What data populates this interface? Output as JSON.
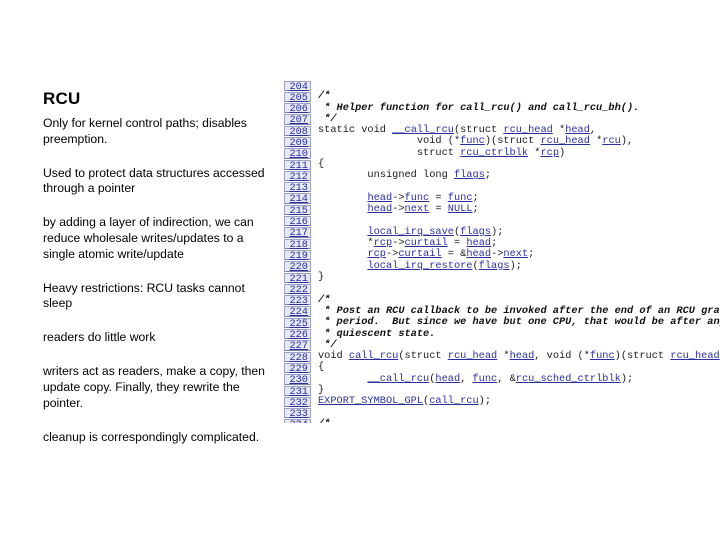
{
  "slide": {
    "title": "RCU",
    "bullets": [
      "Only for kernel control paths; disables preemption.",
      "Used to protect data structures accessed through a pointer",
      "by adding a layer of indirection, we can reduce wholesale writes/updates to a single atomic write/update",
      "Heavy restrictions: RCU tasks cannot sleep",
      "readers do little work",
      "writers act as readers, make a copy, then update copy. Finally, they rewrite the pointer.",
      "cleanup is correspondingly complicated."
    ]
  },
  "code": {
    "lines": [
      {
        "n": "204",
        "segs": []
      },
      {
        "n": "205",
        "segs": [
          {
            "t": "/*",
            "k": "cm"
          }
        ]
      },
      {
        "n": "206",
        "segs": [
          {
            "t": " * Helper function for call_rcu() and call_rcu_bh().",
            "k": "cm"
          }
        ]
      },
      {
        "n": "207",
        "segs": [
          {
            "t": " */",
            "k": "cm"
          }
        ]
      },
      {
        "n": "208",
        "segs": [
          {
            "t": "static void ",
            "k": ""
          },
          {
            "t": "__call_rcu",
            "k": "a"
          },
          {
            "t": "(struct ",
            "k": ""
          },
          {
            "t": "rcu_head",
            "k": "a"
          },
          {
            "t": " *",
            "k": ""
          },
          {
            "t": "head",
            "k": "a"
          },
          {
            "t": ",",
            "k": ""
          }
        ]
      },
      {
        "n": "209",
        "segs": [
          {
            "t": "                void (*",
            "k": ""
          },
          {
            "t": "func",
            "k": "a"
          },
          {
            "t": ")(struct ",
            "k": ""
          },
          {
            "t": "rcu_head",
            "k": "a"
          },
          {
            "t": " *",
            "k": ""
          },
          {
            "t": "rcu",
            "k": "a"
          },
          {
            "t": "),",
            "k": ""
          }
        ]
      },
      {
        "n": "210",
        "segs": [
          {
            "t": "                struct ",
            "k": ""
          },
          {
            "t": "rcu_ctrlblk",
            "k": "a"
          },
          {
            "t": " *",
            "k": ""
          },
          {
            "t": "rcp",
            "k": "a"
          },
          {
            "t": ")",
            "k": ""
          }
        ]
      },
      {
        "n": "211",
        "segs": [
          {
            "t": "{",
            "k": ""
          }
        ]
      },
      {
        "n": "212",
        "segs": [
          {
            "t": "        unsigned long ",
            "k": ""
          },
          {
            "t": "flags",
            "k": "a"
          },
          {
            "t": ";",
            "k": ""
          }
        ]
      },
      {
        "n": "213",
        "segs": []
      },
      {
        "n": "214",
        "segs": [
          {
            "t": "        ",
            "k": ""
          },
          {
            "t": "head",
            "k": "a"
          },
          {
            "t": "->",
            "k": ""
          },
          {
            "t": "func",
            "k": "a"
          },
          {
            "t": " = ",
            "k": ""
          },
          {
            "t": "func",
            "k": "a"
          },
          {
            "t": ";",
            "k": ""
          }
        ]
      },
      {
        "n": "215",
        "segs": [
          {
            "t": "        ",
            "k": ""
          },
          {
            "t": "head",
            "k": "a"
          },
          {
            "t": "->",
            "k": ""
          },
          {
            "t": "next",
            "k": "a"
          },
          {
            "t": " = ",
            "k": ""
          },
          {
            "t": "NULL",
            "k": "a"
          },
          {
            "t": ";",
            "k": ""
          }
        ]
      },
      {
        "n": "216",
        "segs": []
      },
      {
        "n": "217",
        "segs": [
          {
            "t": "        ",
            "k": ""
          },
          {
            "t": "local_irq_save",
            "k": "a"
          },
          {
            "t": "(",
            "k": ""
          },
          {
            "t": "flags",
            "k": "a"
          },
          {
            "t": ");",
            "k": ""
          }
        ]
      },
      {
        "n": "218",
        "segs": [
          {
            "t": "        *",
            "k": ""
          },
          {
            "t": "rcp",
            "k": "a"
          },
          {
            "t": "->",
            "k": ""
          },
          {
            "t": "curtail",
            "k": "a"
          },
          {
            "t": " = ",
            "k": ""
          },
          {
            "t": "head",
            "k": "a"
          },
          {
            "t": ";",
            "k": ""
          }
        ]
      },
      {
        "n": "219",
        "segs": [
          {
            "t": "        ",
            "k": ""
          },
          {
            "t": "rcp",
            "k": "a"
          },
          {
            "t": "->",
            "k": ""
          },
          {
            "t": "curtail",
            "k": "a"
          },
          {
            "t": " = &",
            "k": ""
          },
          {
            "t": "head",
            "k": "a"
          },
          {
            "t": "->",
            "k": ""
          },
          {
            "t": "next",
            "k": "a"
          },
          {
            "t": ";",
            "k": ""
          }
        ]
      },
      {
        "n": "220",
        "segs": [
          {
            "t": "        ",
            "k": ""
          },
          {
            "t": "local_irq_restore",
            "k": "a"
          },
          {
            "t": "(",
            "k": ""
          },
          {
            "t": "flags",
            "k": "a"
          },
          {
            "t": ");",
            "k": ""
          }
        ]
      },
      {
        "n": "221",
        "segs": [
          {
            "t": "}",
            "k": ""
          }
        ]
      },
      {
        "n": "222",
        "segs": []
      },
      {
        "n": "223",
        "segs": [
          {
            "t": "/*",
            "k": "cm"
          }
        ]
      },
      {
        "n": "224",
        "segs": [
          {
            "t": " * Post an RCU callback to be invoked after the end of an RCU grace",
            "k": "cm"
          }
        ]
      },
      {
        "n": "225",
        "segs": [
          {
            "t": " * period.  But since we have but one CPU, that would be after any",
            "k": "cm"
          }
        ]
      },
      {
        "n": "226",
        "segs": [
          {
            "t": " * quiescent state.",
            "k": "cm"
          }
        ]
      },
      {
        "n": "227",
        "segs": [
          {
            "t": " */",
            "k": "cm"
          }
        ]
      },
      {
        "n": "228",
        "segs": [
          {
            "t": "void ",
            "k": ""
          },
          {
            "t": "call_rcu",
            "k": "a"
          },
          {
            "t": "(struct ",
            "k": ""
          },
          {
            "t": "rcu_head",
            "k": "a"
          },
          {
            "t": " *",
            "k": ""
          },
          {
            "t": "head",
            "k": "a"
          },
          {
            "t": ", void (*",
            "k": ""
          },
          {
            "t": "func",
            "k": "a"
          },
          {
            "t": ")(struct ",
            "k": ""
          },
          {
            "t": "rcu_head",
            "k": "a"
          }
        ]
      },
      {
        "n": "229",
        "segs": [
          {
            "t": "{",
            "k": ""
          }
        ]
      },
      {
        "n": "230",
        "segs": [
          {
            "t": "        ",
            "k": ""
          },
          {
            "t": "__call_rcu",
            "k": "a"
          },
          {
            "t": "(",
            "k": ""
          },
          {
            "t": "head",
            "k": "a"
          },
          {
            "t": ", ",
            "k": ""
          },
          {
            "t": "func",
            "k": "a"
          },
          {
            "t": ", &",
            "k": ""
          },
          {
            "t": "rcu_sched_ctrlblk",
            "k": "a"
          },
          {
            "t": ");",
            "k": ""
          }
        ]
      },
      {
        "n": "231",
        "segs": [
          {
            "t": "}",
            "k": ""
          }
        ]
      },
      {
        "n": "232",
        "segs": [
          {
            "t": "EXPORT_SYMBOL_GPL",
            "k": "a"
          },
          {
            "t": "(",
            "k": ""
          },
          {
            "t": "call_rcu",
            "k": "a"
          },
          {
            "t": ");",
            "k": ""
          }
        ]
      },
      {
        "n": "233",
        "segs": []
      },
      {
        "n": "234",
        "segs": [
          {
            "t": "/*",
            "k": "cm"
          }
        ]
      }
    ]
  }
}
